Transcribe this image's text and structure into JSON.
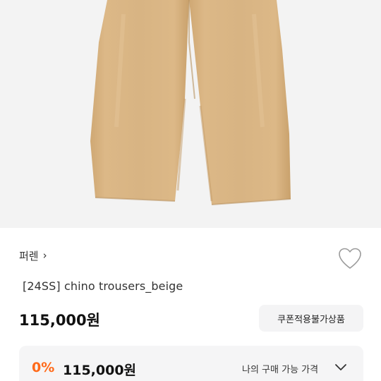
{
  "product": {
    "image_alt": "beige chino trousers",
    "brand": "퍼렌",
    "brand_chevron": "›",
    "title": "[24SS] chino trousers_beige",
    "price": "115,000원",
    "coupon_label": "쿠폰적용불가상품"
  },
  "price_panel": {
    "discount": "0%",
    "final_price": "115,000원",
    "my_price_label": "나의 구매 가능 가격"
  },
  "colors": {
    "discount_accent": "#ff6a1a",
    "product_beige": "#d8b483",
    "panel_bg": "#f5f5f6"
  },
  "icons": {
    "wishlist": "heart-outline-icon",
    "expand": "chevron-down-icon",
    "brand_link": "chevron-right-icon"
  }
}
